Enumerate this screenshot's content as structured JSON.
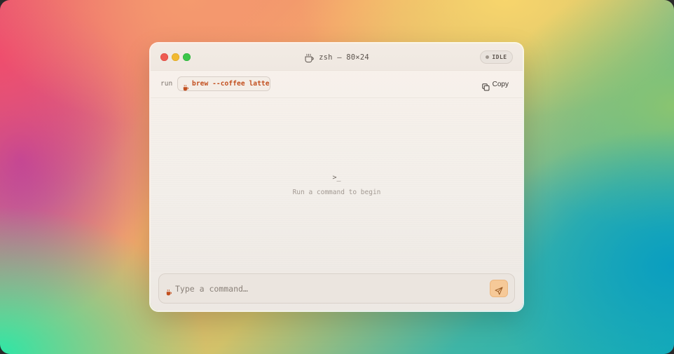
{
  "window": {
    "title": "zsh — 80×24",
    "status": "IDLE"
  },
  "command_bar": {
    "run_label": "run",
    "command": "brew --coffee latte",
    "copy_label": "Copy"
  },
  "output": {
    "prompt_glyph": ">_",
    "empty_message": "Run a command to begin"
  },
  "input": {
    "placeholder": "Type a command…",
    "value": ""
  },
  "icons": {
    "title": "coffee-cup-icon",
    "chip": "coffee-icon",
    "copy": "copy-icon",
    "send": "send-icon"
  },
  "colors": {
    "accent": "#c24e1d",
    "send_button": "#f6c998",
    "traffic_red": "#ee5b51",
    "traffic_yellow": "#f1b931",
    "traffic_green": "#3cc64a"
  }
}
